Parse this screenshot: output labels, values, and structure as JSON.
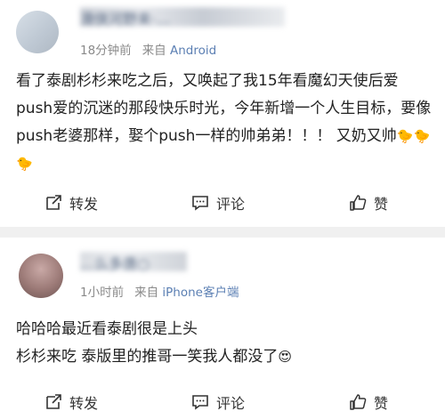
{
  "posts": [
    {
      "username": "滑侠河野来·…",
      "time": "18分钟前",
      "source_prefix": "来自",
      "source": "Android",
      "text": "看了泰剧杉杉来吃之后，又唤起了我15年看魔幻天使后爱push爱的沉迷的那段快乐时光，今年新增一个人生目标，要像push老婆那样，娶个push一样的帅弟弟！！！ 又奶又帅",
      "text_emoji": "🐤🐤🐤",
      "actions": {
        "repost": "转发",
        "comment": "评论",
        "like": "赞"
      }
    },
    {
      "username": "…么多唐○",
      "time": "1小时前",
      "source_prefix": "来自",
      "source": "iPhone客户端",
      "text": "哈哈哈最近看泰剧很是上头\n杉杉来吃 泰版里的推哥一笑我人都没了",
      "text_emoji": "😍",
      "actions": {
        "repost": "转发",
        "comment": "评论",
        "like": "赞"
      }
    }
  ]
}
